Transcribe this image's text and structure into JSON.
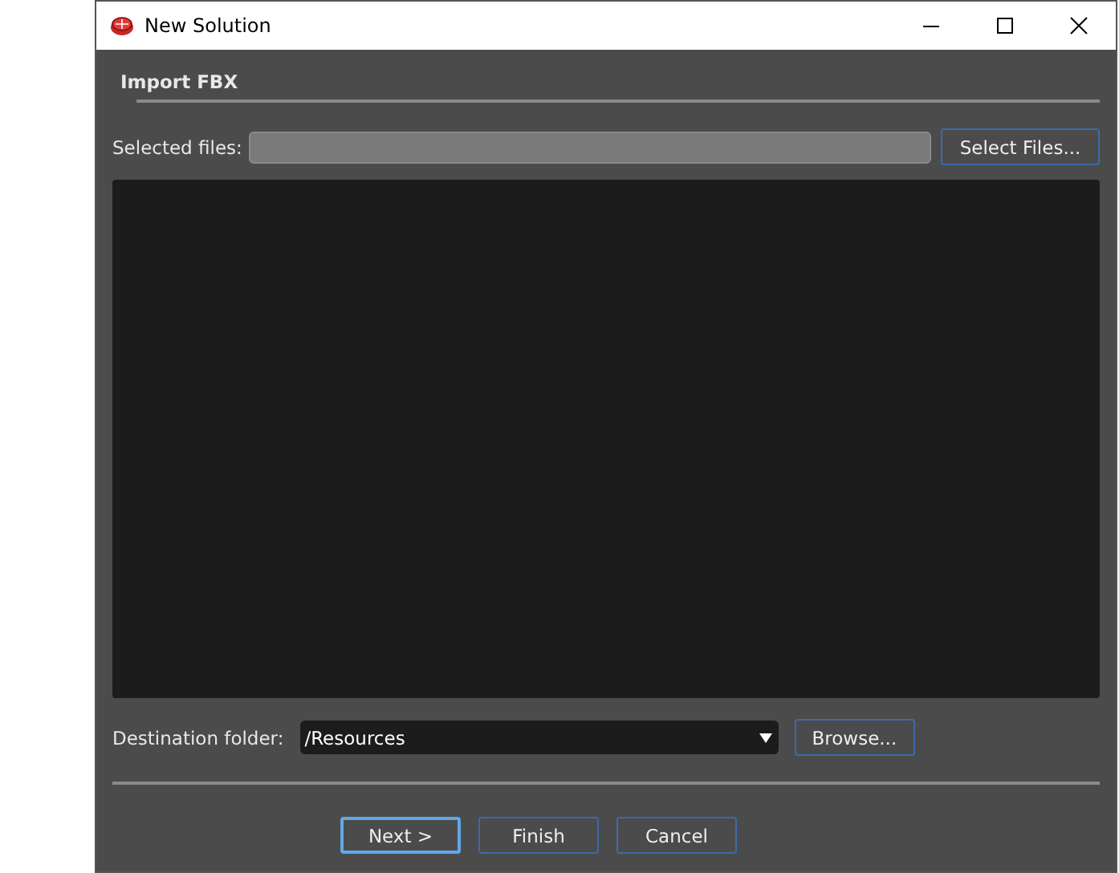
{
  "window": {
    "title": "New Solution"
  },
  "section": {
    "title": "Import FBX"
  },
  "selected_files": {
    "label": "Selected files:",
    "button": "Select Files..."
  },
  "destination": {
    "label": "Destination folder:",
    "value": "/Resources",
    "button": "Browse..."
  },
  "buttons": [
    {
      "label": "Next >",
      "focused": true
    },
    {
      "label": "Finish",
      "focused": false
    },
    {
      "label": "Cancel",
      "focused": false
    }
  ]
}
